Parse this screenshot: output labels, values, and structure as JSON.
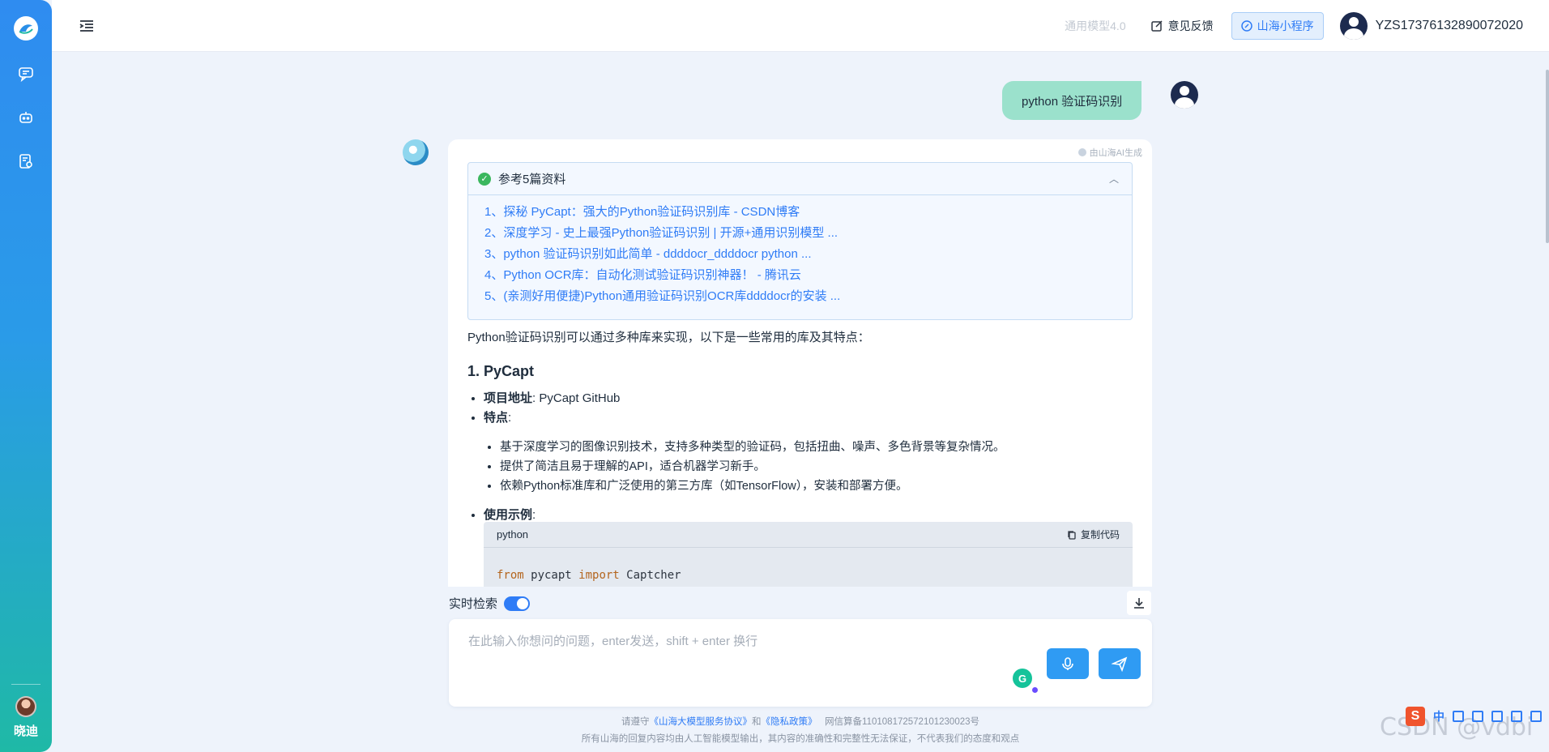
{
  "sidebar": {
    "icons": [
      "logo-icon",
      "chat-icon",
      "robot-icon",
      "document-icon"
    ],
    "user_name": "晓迪"
  },
  "header": {
    "model_label": "通用模型4.0",
    "feedback_label": "意见反馈",
    "mini_program_label": "山海小程序",
    "user_id": "YZS17376132890072020"
  },
  "chat": {
    "user_message": "python 验证码识别",
    "ai_tag": "由山海AI生成",
    "references": {
      "title": "参考5篇资料",
      "items": [
        "1、探秘 PyCapt：强大的Python验证码识别库 - CSDN博客",
        "2、深度学习 - 史上最强Python验证码识别 | 开源+通用识别模型 ...",
        "3、python 验证码识别如此简单 - ddddocr_ddddocr python ...",
        "4、Python OCR库：自动化测试验证码识别神器！ - 腾讯云",
        "5、(亲测好用便捷)Python通用验证码识别OCR库ddddocr的安装 ..."
      ]
    },
    "intro": "Python验证码识别可以通过多种库来实现，以下是一些常用的库及其特点：",
    "section1_title": "1. PyCapt",
    "project_label": "项目地址",
    "project_value": ": PyCapt GitHub",
    "features_label": "特点",
    "features_colon": ":",
    "features": [
      "基于深度学习的图像识别技术，支持多种类型的验证码，包括扭曲、噪声、多色背景等复杂情况。",
      "提供了简洁且易于理解的API，适合机器学习新手。",
      "依赖Python标准库和广泛使用的第三方库（如TensorFlow），安装和部署方便。"
    ],
    "usage_label": "使用示例",
    "usage_colon": ":",
    "code": {
      "language": "python",
      "copy_label": "复制代码",
      "kw_from": "from",
      "module": " pycapt ",
      "kw_import": "import",
      "name": " Captcher"
    }
  },
  "input": {
    "realtime_label": "实时检索",
    "realtime_on": true,
    "placeholder": "在此输入你想问的问题，enter发送，shift + enter 换行"
  },
  "footer": {
    "prefix": "请遵守",
    "agreement": "《山海大模型服务协议》",
    "and": "和",
    "privacy": "《隐私政策》",
    "icp": "网信算备110108172572101230023号",
    "disclaimer": "所有山海的回复内容均由人工智能模型输出，其内容的准确性和完整性无法保证，不代表我们的态度和观点"
  },
  "watermark": "CSDN @vdbi",
  "ime": {
    "lang": "中"
  },
  "colors": {
    "accent": "#2f7cf6",
    "user_bubble": "#9be1cc",
    "link": "#2f7cf6"
  }
}
